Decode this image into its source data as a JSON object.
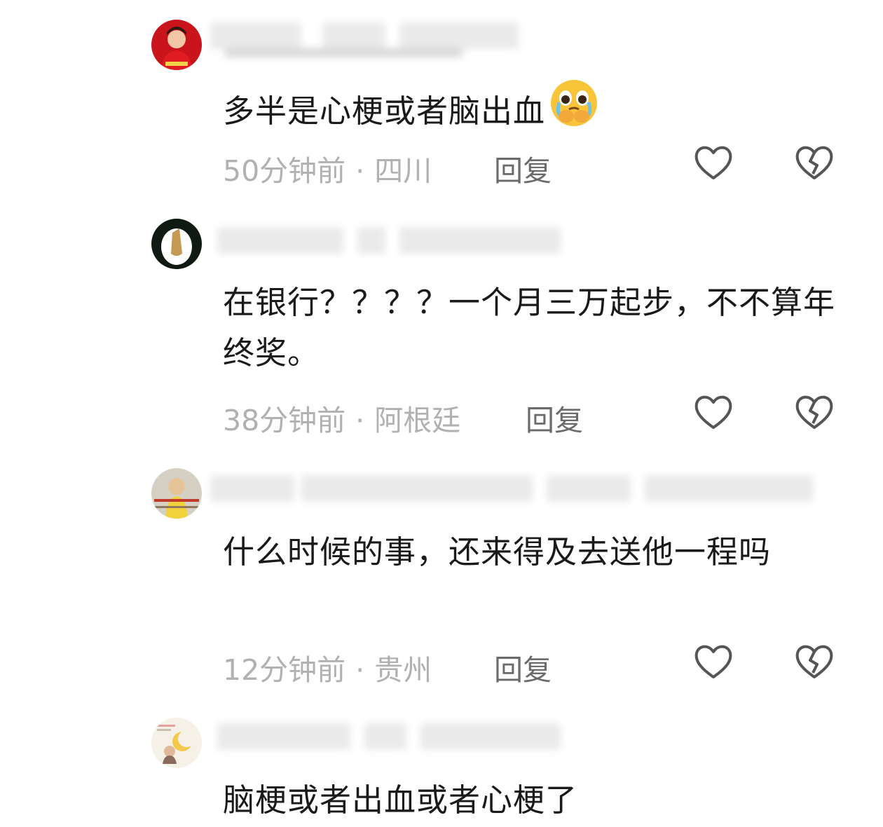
{
  "comments": [
    {
      "text": "多半是心梗或者脑出血",
      "time": "50分钟前",
      "location": "四川",
      "reply_label": "回复",
      "has_emoji": true
    },
    {
      "text": "在银行？？？？一个月三万起步，不不算年终奖。",
      "time": "38分钟前",
      "location": "阿根廷",
      "reply_label": "回复"
    },
    {
      "text": "什么时候的事，还来得及去送他一程吗",
      "time": "12分钟前",
      "location": "贵州",
      "reply_label": "回复"
    },
    {
      "text": "脑梗或者出血或者心梗了"
    }
  ],
  "icons": {
    "like": "heart-outline-icon",
    "dislike": "broken-heart-icon",
    "emoji": "crying-face-emoji-icon"
  },
  "colors": {
    "text": "#1a1a1a",
    "meta": "#b1b1b1",
    "reply": "#6b6b6b",
    "icon": "#555555"
  }
}
